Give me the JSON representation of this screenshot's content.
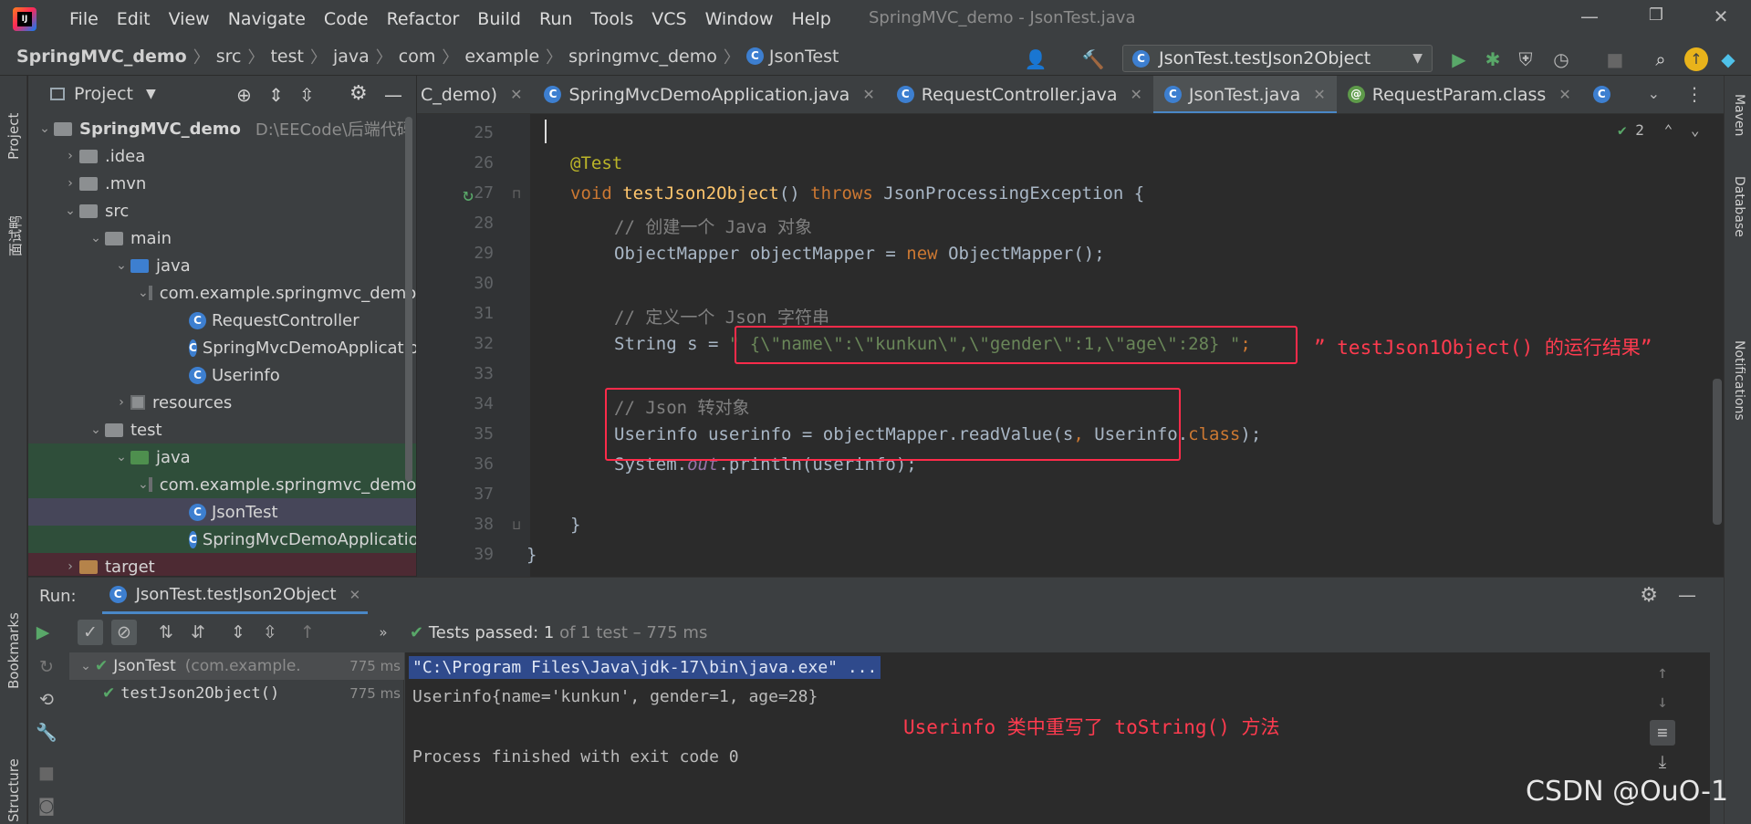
{
  "window": {
    "title": "SpringMVC_demo - JsonTest.java",
    "menu": [
      "File",
      "Edit",
      "View",
      "Navigate",
      "Code",
      "Refactor",
      "Build",
      "Run",
      "Tools",
      "VCS",
      "Window",
      "Help"
    ],
    "controls": {
      "minimize": "—",
      "restore": "❐",
      "close": "✕"
    }
  },
  "breadcrumb": [
    "SpringMVC_demo",
    "src",
    "test",
    "java",
    "com",
    "example",
    "springmvc_demo",
    "JsonTest"
  ],
  "run_config": "JsonTest.testJson2Object",
  "left_strip": {
    "project": "Project",
    "interview": "面试鸭",
    "bookmarks": "Bookmarks",
    "structure": "Structure"
  },
  "right_strip": {
    "maven": "Maven",
    "database": "Database",
    "notifications": "Notifications"
  },
  "project": {
    "header": "Project",
    "root_name": "SpringMVC_demo",
    "root_path": "D:\\EECode\\后端代码",
    "items": [
      {
        "label": ".idea"
      },
      {
        "label": ".mvn"
      },
      {
        "label": "src"
      },
      {
        "label": "main"
      },
      {
        "label": "java"
      },
      {
        "label": "com.example.springmvc_demo"
      },
      {
        "label": "RequestController"
      },
      {
        "label": "SpringMvcDemoApplication"
      },
      {
        "label": "Userinfo"
      },
      {
        "label": "resources"
      },
      {
        "label": "test"
      },
      {
        "label": "java"
      },
      {
        "label": "com.example.springmvc_demo"
      },
      {
        "label": "JsonTest"
      },
      {
        "label": "SpringMvcDemoApplicationTests"
      },
      {
        "label": "target"
      }
    ]
  },
  "tabs": [
    {
      "label": "C_demo)"
    },
    {
      "label": "SpringMvcDemoApplication.java"
    },
    {
      "label": "RequestController.java"
    },
    {
      "label": "JsonTest.java"
    },
    {
      "label": "RequestParam.class"
    }
  ],
  "editor": {
    "inspection_count": "2",
    "line_numbers": [
      "25",
      "26",
      "27",
      "28",
      "29",
      "30",
      "31",
      "32",
      "33",
      "34",
      "35",
      "36",
      "37",
      "38",
      "39"
    ],
    "lines": {
      "l26": "@Test",
      "l27_kw": "void",
      "l27_fn": "testJson2Object",
      "l27_rest1": "() ",
      "l27_throws": "throws",
      "l27_rest2": " JsonProcessingException {",
      "l28": "// 创建一个 Java 对象",
      "l29_a": "ObjectMapper objectMapper = ",
      "l29_new": "new",
      "l29_b": " ObjectMapper();",
      "l31": "// 定义一个 Json 字符串",
      "l32_a": "String s = ",
      "l32_str": "\" {\\\"name\\\":\\\"kunkun\\\",\\\"gender\\\":1,\\\"age\\\":28} \"",
      "l32_b": ";",
      "l34": "// Json 转对象",
      "l35_a": "Userinfo userinfo = objectMapper.readValue(s",
      "l35_comma": ",",
      "l35_b": " Userinfo.",
      "l35_class": "class",
      "l35_c": ");",
      "l36_a": "System.",
      "l36_out": "out",
      "l36_b": ".println(userinfo);",
      "l38": "}",
      "l39": "}"
    },
    "annotation_1": "” testJson1Object() 的运行结果”",
    "annotation_2": "Userinfo 类中重写了 toString() 方法"
  },
  "run": {
    "label": "Run:",
    "tab": "JsonTest.testJson2Object",
    "status_prefix": "Tests passed:",
    "status_count": "1",
    "status_suffix": "of 1 test – 775 ms",
    "tree": [
      {
        "name": "JsonTest",
        "pkg": "(com.example.",
        "time": "775 ms"
      },
      {
        "name": "testJson2Object()",
        "time": "775 ms"
      }
    ],
    "console": [
      "\"C:\\Program Files\\Java\\jdk-17\\bin\\java.exe\" ...",
      "Userinfo{name='kunkun', gender=1, age=28}",
      "Process finished with exit code 0"
    ]
  },
  "watermark": "CSDN @OuO-1",
  "colors": {
    "accent": "#4a88c7",
    "annotation_red": "#ff2b4a",
    "pass_green": "#59a869"
  }
}
